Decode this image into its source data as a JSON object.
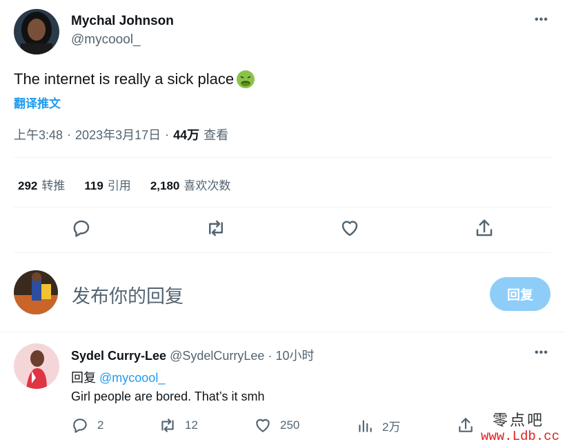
{
  "tweet": {
    "author_name": "Mychal Johnson",
    "author_handle": "@mycoool_",
    "more_label": "•••",
    "text": "The internet is really a sick place",
    "emoji": "nauseated-face",
    "translate_label": "翻译推文",
    "time": "上午3:48",
    "separator": "·",
    "date": "2023年3月17日",
    "views_count": "44万",
    "views_label": "查看"
  },
  "stats": {
    "retweets_count": "292",
    "retweets_label": "转推",
    "quotes_count": "119",
    "quotes_label": "引用",
    "likes_count": "2,180",
    "likes_label": "喜欢次数"
  },
  "actions": [
    "reply-icon",
    "retweet-icon",
    "like-icon",
    "share-icon"
  ],
  "compose": {
    "placeholder": "发布你的回复",
    "button_label": "回复"
  },
  "reply": {
    "author_name": "Sydel Curry-Lee",
    "author_handle": "@SydelCurryLee",
    "separator": "·",
    "time": "10小时",
    "more_label": "•••",
    "replying_label": "回复",
    "replying_to": "@mycoool_",
    "text": "Girl people are bored. That’s it smh",
    "reply_count": "2",
    "retweet_count": "12",
    "like_count": "250",
    "views_count": "2万"
  },
  "watermark": {
    "cn": "零点吧",
    "url": "www.Ldb.cc"
  },
  "colors": {
    "accent": "#1d9bf0",
    "reply_button": "#8ecdf8",
    "secondary_text": "#536471",
    "divider": "#eff3f4",
    "watermark_url": "#e02020"
  }
}
